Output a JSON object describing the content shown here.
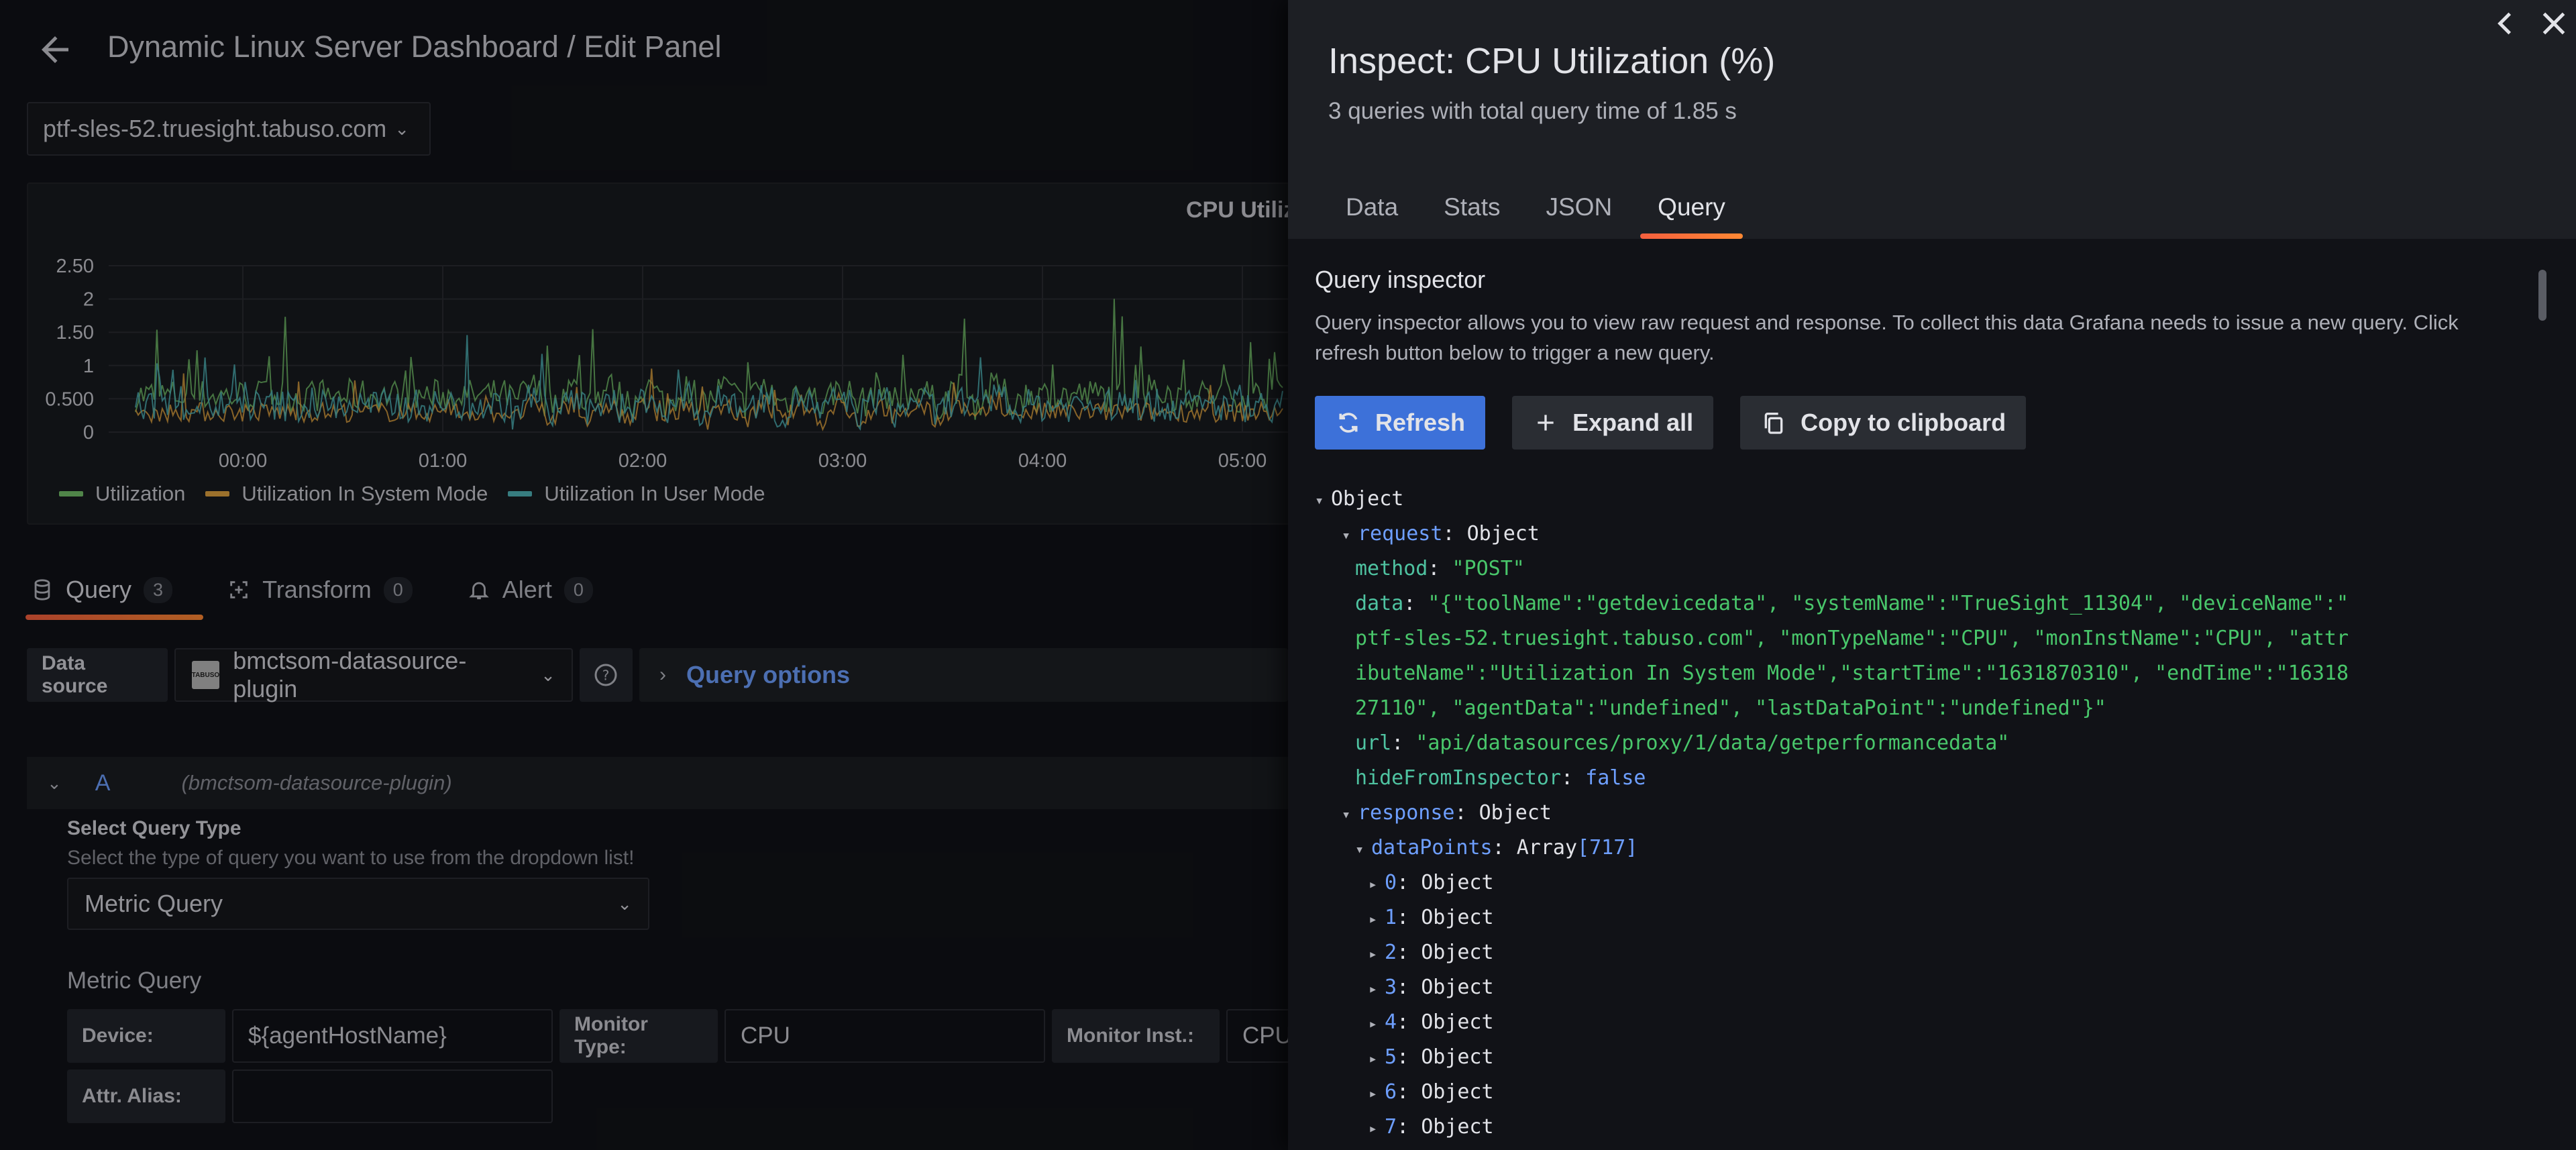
{
  "editor": {
    "title": "Dynamic Linux Server Dashboard / Edit Panel",
    "host": "ptf-sles-52.truesight.tabuso.com",
    "panel_title": "CPU Utilization",
    "tabs": [
      {
        "label": "Query",
        "count": "3"
      },
      {
        "label": "Transform",
        "count": "0"
      },
      {
        "label": "Alert",
        "count": "0"
      }
    ],
    "datasource_label": "Data source",
    "datasource": "bmctsom-datasource-plugin",
    "datasource_logo_text": "TABUSO",
    "query_options": "Query options",
    "query_letter": "A",
    "query_ds": "(bmctsom-datasource-plugin)",
    "select_query_type_label": "Select Query Type",
    "select_query_type_desc": "Select the type of query you want to use from the dropdown list!",
    "query_type": "Metric Query",
    "metric_query_title": "Metric Query",
    "device_label": "Device:",
    "device_value": "${agentHostName}",
    "monitor_type_label": "Monitor Type:",
    "monitor_type_value": "CPU",
    "monitor_inst_label": "Monitor Inst.:",
    "monitor_inst_value": "CPU",
    "attr_alias_label": "Attr. Alias:",
    "attr_alias_value": ""
  },
  "chart_data": {
    "type": "line",
    "title": "CPU Utiliz",
    "x_ticks": [
      "00:00",
      "01:00",
      "02:00",
      "03:00",
      "04:00",
      "05:00"
    ],
    "y_ticks": [
      "0",
      "0.500",
      "1",
      "1.50",
      "2",
      "2.50"
    ],
    "ylim": [
      0,
      2.5
    ],
    "legend_position": "bottom-left",
    "series": [
      {
        "name": "Utilization",
        "color": "#73bf69"
      },
      {
        "name": "Utilization In System Mode",
        "color": "#e0a23f"
      },
      {
        "name": "Utilization In User Mode",
        "color": "#4fb4b8"
      }
    ]
  },
  "drawer": {
    "title": "Inspect: CPU Utilization (%)",
    "subtitle": "3 queries with total query time of 1.85 s",
    "tabs": [
      "Data",
      "Stats",
      "JSON",
      "Query"
    ],
    "active_tab": "Query",
    "qi_title": "Query inspector",
    "qi_desc": "Query inspector allows you to view raw request and response. To collect this data Grafana needs to issue a new query. Click refresh button below to trigger a new query.",
    "buttons": {
      "refresh": "Refresh",
      "expand": "Expand all",
      "copy": "Copy to clipboard"
    }
  },
  "tree": {
    "root": "Object",
    "request_key": "request",
    "request_type": "Object",
    "method_key": "method",
    "method_val": "\"POST\"",
    "data_key": "data",
    "data_lines": [
      "\"{\"toolName\":\"getdevicedata\", \"systemName\":\"TrueSight_11304\", \"deviceName\":\"",
      "ptf-sles-52.truesight.tabuso.com\", \"monTypeName\":\"CPU\", \"monInstName\":\"CPU\", \"attr",
      "ibuteName\":\"Utilization In System Mode\",\"startTime\":\"1631870310\", \"endTime\":\"16318",
      "27110\", \"agentData\":\"undefined\", \"lastDataPoint\":\"undefined\"}\""
    ],
    "url_key": "url",
    "url_val": "\"api/datasources/proxy/1/data/getperformancedata\"",
    "hide_key": "hideFromInspector",
    "hide_val": "false",
    "response_key": "response",
    "response_type": "Object",
    "dp_key": "dataPoints",
    "dp_type": "Array",
    "dp_count": "[717]",
    "items": [
      {
        "idx": "0",
        "type": "Object"
      },
      {
        "idx": "1",
        "type": "Object"
      },
      {
        "idx": "2",
        "type": "Object"
      },
      {
        "idx": "3",
        "type": "Object"
      },
      {
        "idx": "4",
        "type": "Object"
      },
      {
        "idx": "5",
        "type": "Object"
      },
      {
        "idx": "6",
        "type": "Object"
      },
      {
        "idx": "7",
        "type": "Object"
      }
    ]
  }
}
